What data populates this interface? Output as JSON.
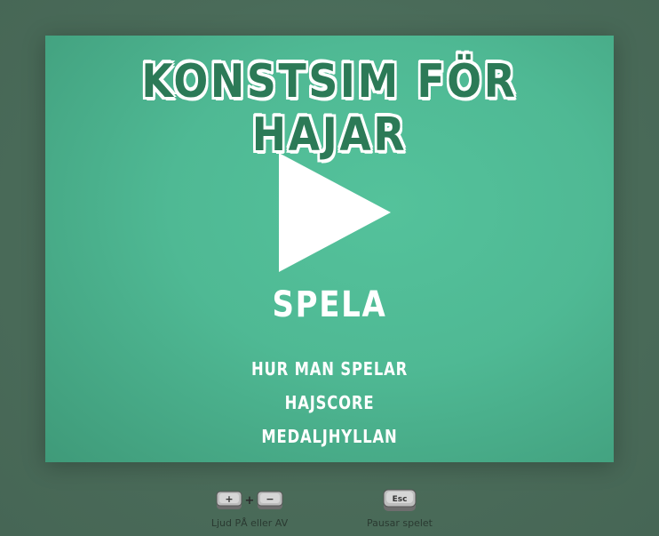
{
  "game": {
    "title": "KONSTSIM FÖR HAJAR",
    "play_label": "SPELA",
    "play_icon": "play-triangle-icon",
    "menu": [
      {
        "label": "HUR MAN SPELAR"
      },
      {
        "label": "HAJSCORE"
      },
      {
        "label": "MEDALJHYLLAN"
      }
    ]
  },
  "controls": {
    "sound": {
      "keys": [
        "+",
        "−"
      ],
      "separator": "+",
      "label": "Ljud PÅ eller AV"
    },
    "pause": {
      "key": "Esc",
      "label": "Pausar spelet"
    }
  },
  "colors": {
    "page_background": "#4a6e5a",
    "panel_green": "#4fb994",
    "title_text": "#2c7a57",
    "text_white": "#ffffff",
    "key_gray": "#9a9a9a"
  }
}
